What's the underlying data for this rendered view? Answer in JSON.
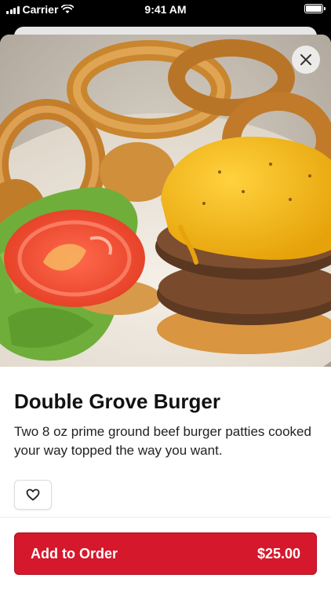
{
  "status_bar": {
    "carrier": "Carrier",
    "time": "9:41 AM"
  },
  "item": {
    "title": "Double Grove Burger",
    "description": "Two 8 oz prime ground beef burger patties cooked your way topped the way you want."
  },
  "icons": {
    "close": "close-icon",
    "favorite": "heart-icon",
    "wifi": "wifi-icon",
    "battery": "battery-icon"
  },
  "order_button": {
    "label": "Add to Order",
    "price": "$25.00"
  },
  "colors": {
    "accent": "#d5182b",
    "cheese": "#f3b512"
  }
}
